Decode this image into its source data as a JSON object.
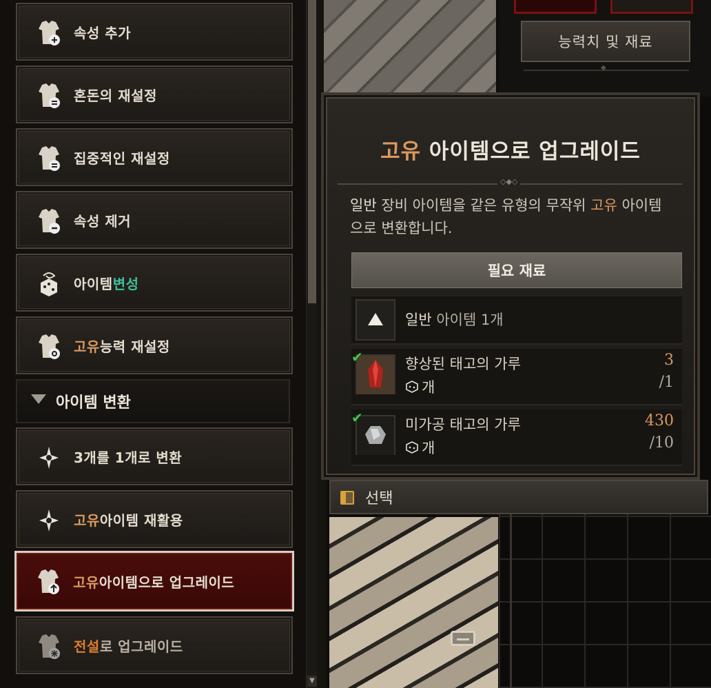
{
  "menu": {
    "items": [
      {
        "label": "속성 추가",
        "icon": "armor-plus-icon"
      },
      {
        "label": "혼돈의 재설정",
        "icon": "armor-reset-icon"
      },
      {
        "label": "집중적인 재설정",
        "icon": "armor-reset-icon"
      },
      {
        "label": "속성 제거",
        "icon": "armor-minus-icon"
      },
      {
        "label_plain": "아이템 ",
        "label_highlight": "변성",
        "icon": "dice-swirl-icon"
      },
      {
        "label_highlight": "고유",
        "label_plain": " 능력 재설정",
        "icon": "armor-gear-icon"
      }
    ],
    "section_header": "아이템 변환",
    "section_items": [
      {
        "label": "3개를 1개로 변환",
        "icon": "spiky-star-icon"
      },
      {
        "label_highlight": "고유",
        "label_plain": " 아이템 재활용",
        "icon": "spiky-star-icon"
      },
      {
        "label_highlight": "고유",
        "label_plain": " 아이템으로 업그레이드",
        "icon": "armor-upgrade-icon",
        "selected": true
      },
      {
        "label_highlight": "전설",
        "label_plain": "로 업그레이드",
        "icon": "armor-snowflake-icon"
      }
    ]
  },
  "stats_button": "능력치 및 재료",
  "tooltip": {
    "title_highlight": "고유",
    "title_plain": " 아이템으로 업그레이드",
    "desc_1": "일반",
    "desc_2": " 장비 아이템을 같은 유형의 무작위 ",
    "desc_3": "고유",
    "desc_4": " 아이템으로 변환합니다.",
    "requirements_header": "필요 재료",
    "requirements": [
      {
        "name_highlight": "일반",
        "name_plain": " 아이템 1개"
      },
      {
        "name": "향상된 태고의 가루",
        "unit": "개",
        "have": "3",
        "need": "/1",
        "checked": true
      },
      {
        "name": "미가공 태고의 가루",
        "unit": "개",
        "have": "430",
        "need": "/10",
        "checked": true
      }
    ]
  },
  "select_label": "선택",
  "colors": {
    "unique": "#d89a5f",
    "magic_green": "#3cc19a",
    "legendary": "#e07d2c",
    "selected_bg": "#4a0d0a"
  }
}
